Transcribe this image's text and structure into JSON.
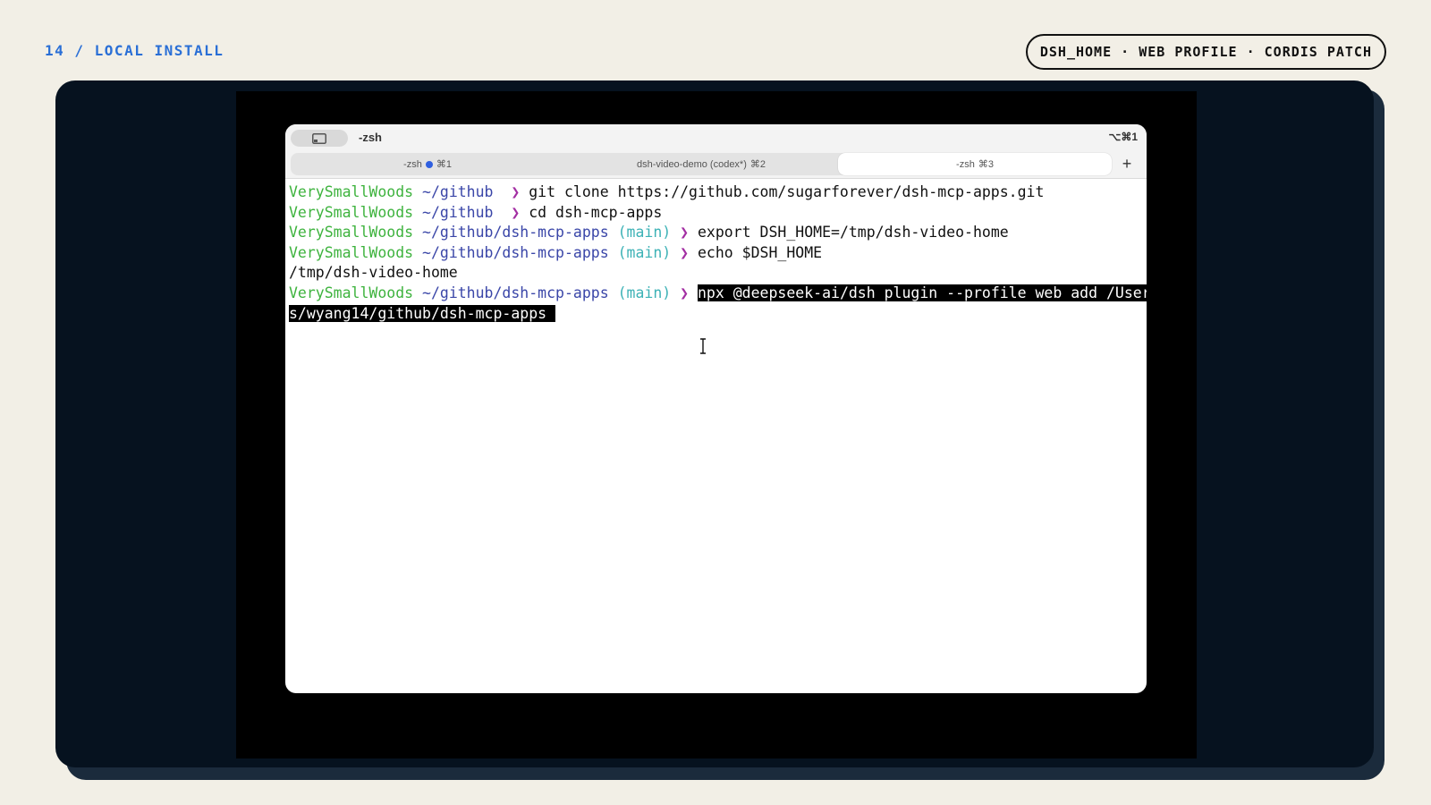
{
  "slide": {
    "label": "14 / LOCAL INSTALL",
    "pill": "DSH_HOME · WEB PROFILE · CORDIS PATCH"
  },
  "terminal": {
    "window_title": "-zsh",
    "window_shortcut": "⌥⌘1",
    "tabs": [
      {
        "title": "-zsh",
        "shortcut": "⌘1",
        "has_activity_dot": true,
        "active": false
      },
      {
        "title": "dsh-video-demo (codex*)",
        "shortcut": "⌘2",
        "active": false
      },
      {
        "title": "-zsh",
        "shortcut": "⌘3",
        "active": true
      }
    ],
    "new_tab_label": "+",
    "prompt_glyph": "❯",
    "lines": [
      {
        "host": "VerySmallWoods",
        "path": "~/github",
        "branch": "",
        "command": "git clone https://github.com/sugarforever/dsh-mcp-apps.git"
      },
      {
        "host": "VerySmallWoods",
        "path": "~/github",
        "branch": "",
        "command": "cd dsh-mcp-apps"
      },
      {
        "host": "VerySmallWoods",
        "path": "~/github/dsh-mcp-apps",
        "branch": "(main)",
        "command": "export DSH_HOME=/tmp/dsh-video-home"
      },
      {
        "host": "VerySmallWoods",
        "path": "~/github/dsh-mcp-apps",
        "branch": "(main)",
        "command": "echo $DSH_HOME"
      },
      {
        "output": "/tmp/dsh-video-home"
      },
      {
        "host": "VerySmallWoods",
        "path": "~/github/dsh-mcp-apps",
        "branch": "(main)",
        "command": "npx @deepseek-ai/dsh plugin --profile web add /User",
        "selected": true
      },
      {
        "output": "s/wyang14/github/dsh-mcp-apps ",
        "selected": true
      }
    ]
  },
  "colors": {
    "accent_label": "#2a6fd6",
    "host": "#3eb33e",
    "path": "#3a46a8",
    "branch": "#3db2b6",
    "prompt_arrow": "#a32fa3",
    "activity_dot": "#2f5fe0"
  }
}
